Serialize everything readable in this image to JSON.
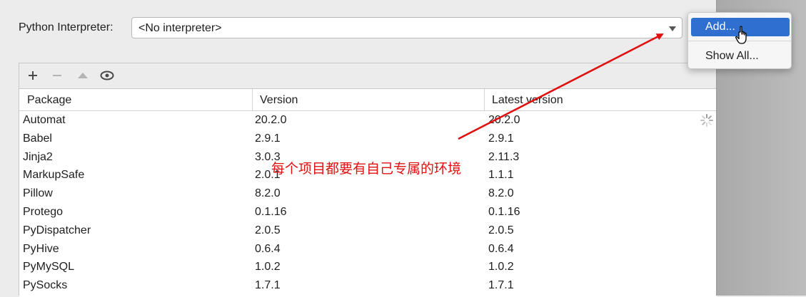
{
  "interpreter": {
    "label": "Python Interpreter:",
    "value": "<No interpreter>"
  },
  "toolbar": {
    "add_icon": "plus-icon",
    "remove_icon": "minus-icon",
    "upgrade_icon": "triangle-up-icon",
    "show_icon": "eye-icon"
  },
  "table": {
    "headers": [
      "Package",
      "Version",
      "Latest version"
    ],
    "rows": [
      [
        "Automat",
        "20.2.0",
        "20.2.0"
      ],
      [
        "Babel",
        "2.9.1",
        "2.9.1"
      ],
      [
        "Jinja2",
        "3.0.3",
        "2.11.3"
      ],
      [
        "MarkupSafe",
        "2.0.1",
        "1.1.1"
      ],
      [
        "Pillow",
        "8.2.0",
        "8.2.0"
      ],
      [
        "Protego",
        "0.1.16",
        "0.1.16"
      ],
      [
        "PyDispatcher",
        "2.0.5",
        "2.0.5"
      ],
      [
        "PyHive",
        "0.6.4",
        "0.6.4"
      ],
      [
        "PyMySQL",
        "1.0.2",
        "1.0.2"
      ],
      [
        "PySocks",
        "1.7.1",
        "1.7.1"
      ]
    ]
  },
  "popup_menu": {
    "add": "Add...",
    "show_all": "Show All..."
  },
  "annotation": {
    "text": "每个项目都要有自己专属的环境",
    "color": "#e01010"
  },
  "colors": {
    "selection": "#2f6fd0",
    "background": "#ececec"
  }
}
